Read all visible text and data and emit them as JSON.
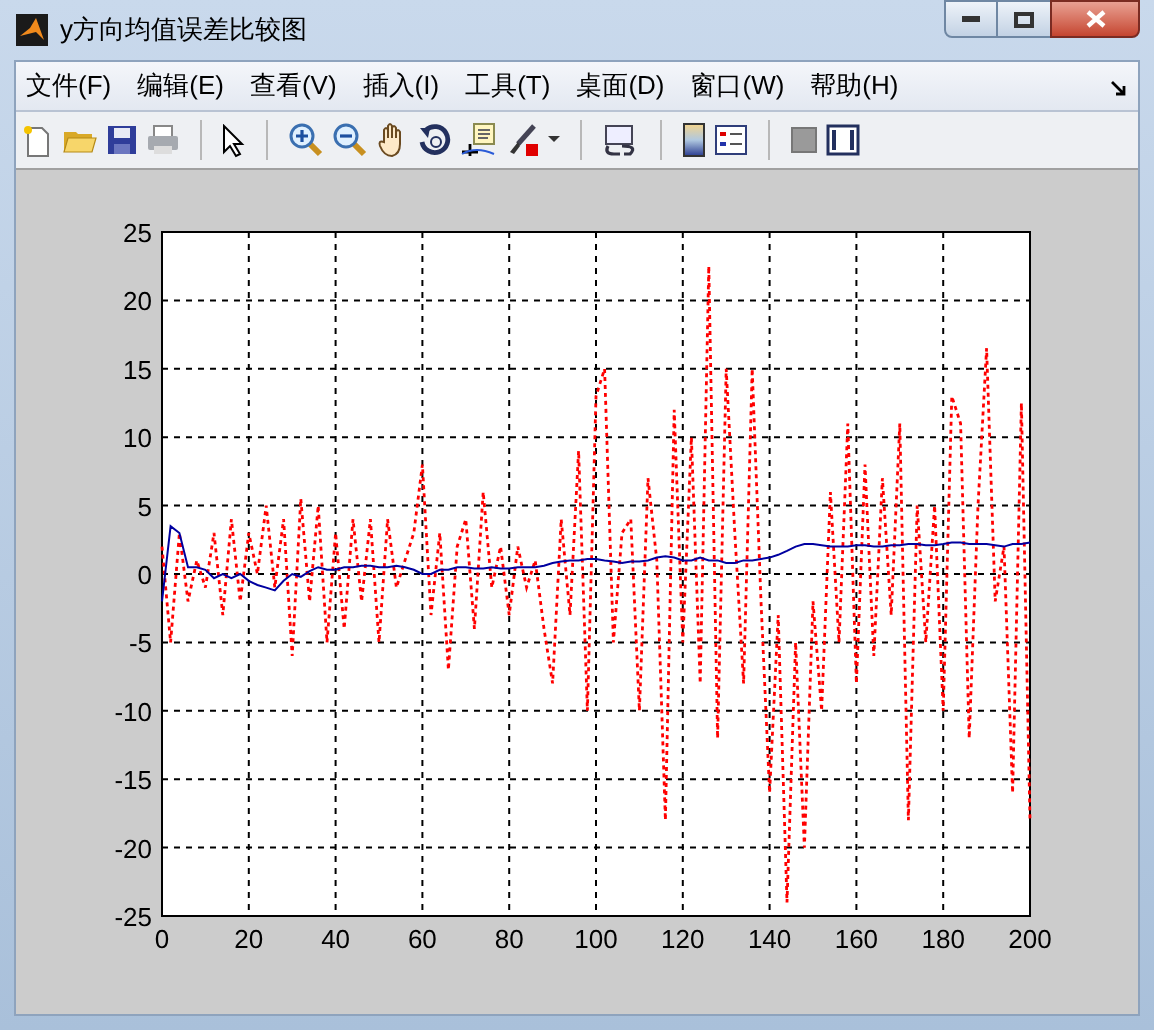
{
  "window": {
    "title": "y方向均值误差比较图"
  },
  "menu": [
    "文件(F)",
    "编辑(E)",
    "查看(V)",
    "插入(I)",
    "工具(T)",
    "桌面(D)",
    "窗口(W)",
    "帮助(H)"
  ],
  "figure": {
    "chart_data": {
      "type": "line",
      "x": [
        0,
        2,
        4,
        6,
        8,
        10,
        12,
        14,
        16,
        18,
        20,
        22,
        24,
        26,
        28,
        30,
        32,
        34,
        36,
        38,
        40,
        42,
        44,
        46,
        48,
        50,
        52,
        54,
        56,
        58,
        60,
        62,
        64,
        66,
        68,
        70,
        72,
        74,
        76,
        78,
        80,
        82,
        84,
        86,
        88,
        90,
        92,
        94,
        96,
        98,
        100,
        102,
        104,
        106,
        108,
        110,
        112,
        114,
        116,
        118,
        120,
        122,
        124,
        126,
        128,
        130,
        132,
        134,
        136,
        138,
        140,
        142,
        144,
        146,
        148,
        150,
        152,
        154,
        156,
        158,
        160,
        162,
        164,
        166,
        168,
        170,
        172,
        174,
        176,
        178,
        180,
        182,
        184,
        186,
        188,
        190,
        192,
        194,
        196,
        198,
        200
      ],
      "series": [
        {
          "color": "#ff0000",
          "line_style": "dotted",
          "values": [
            2,
            -5,
            3,
            -2,
            1,
            -1,
            3,
            -3,
            4,
            -2,
            3,
            0,
            5,
            -1,
            4,
            -6,
            5.5,
            -2,
            5,
            -5,
            3,
            -4,
            4,
            -2,
            4,
            -5,
            4,
            -1,
            1,
            3,
            8,
            -3,
            3,
            -7,
            2,
            4,
            -4,
            6,
            -1,
            2,
            -3,
            2,
            -1,
            1,
            -4,
            -8,
            4,
            -3,
            9,
            -10,
            13,
            15,
            -5,
            3,
            4,
            -10,
            7,
            1,
            -18,
            12,
            -5,
            10,
            -8,
            22.5,
            -12,
            15,
            3,
            -8,
            15,
            -2,
            -16,
            -3,
            -24,
            -5,
            -20,
            -2,
            -10,
            6,
            -5,
            11,
            -8,
            8,
            -6,
            7,
            -3,
            11,
            -18,
            5,
            -5,
            5,
            -10,
            13,
            11,
            -12,
            5,
            16.5,
            -2,
            2,
            -16,
            12.5,
            -18
          ]
        },
        {
          "color": "#0000a0",
          "line_style": "solid",
          "values": [
            -2,
            3.5,
            3,
            0.5,
            0.5,
            0.3,
            -0.3,
            0,
            -0.3,
            0,
            -0.5,
            -0.8,
            -1,
            -1.2,
            -0.5,
            0,
            -0.2,
            0.2,
            0.5,
            0.3,
            0.3,
            0.5,
            0.5,
            0.6,
            0.6,
            0.5,
            0.5,
            0.6,
            0.5,
            0.3,
            0,
            0,
            0.3,
            0.3,
            0.5,
            0.5,
            0.4,
            0.4,
            0.5,
            0.4,
            0.4,
            0.5,
            0.5,
            0.5,
            0.6,
            0.8,
            0.9,
            1,
            1,
            1.1,
            1.1,
            1,
            0.9,
            0.8,
            0.9,
            0.9,
            1,
            1.2,
            1.3,
            1.2,
            1,
            1,
            1.2,
            1,
            1,
            0.8,
            0.8,
            1,
            1,
            1.1,
            1.2,
            1.4,
            1.7,
            2,
            2.2,
            2.2,
            2.1,
            2,
            2,
            2,
            2.1,
            2.1,
            2,
            2,
            2.1,
            2.1,
            2.2,
            2.2,
            2.1,
            2.1,
            2.2,
            2.3,
            2.3,
            2.2,
            2.2,
            2.2,
            2.1,
            2,
            2.2,
            2.2,
            2.3
          ]
        }
      ],
      "grid": true,
      "xlim": [
        0,
        200
      ],
      "ylim": [
        -25,
        25
      ],
      "xticks": [
        0,
        20,
        40,
        60,
        80,
        100,
        120,
        140,
        160,
        180,
        200
      ],
      "yticks": [
        -25,
        -20,
        -15,
        -10,
        -5,
        0,
        5,
        10,
        15,
        20,
        25
      ]
    }
  }
}
